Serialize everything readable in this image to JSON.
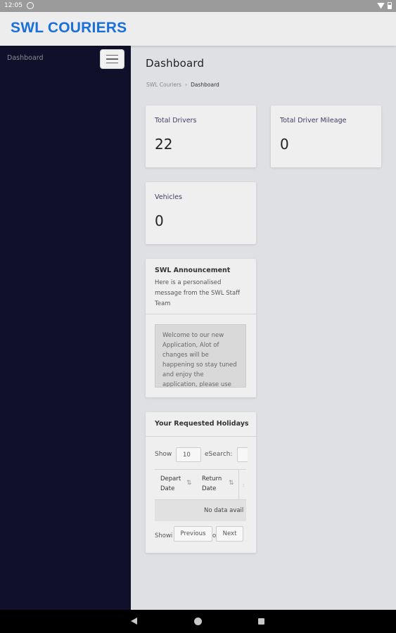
{
  "status_bar": {
    "time": "12:05"
  },
  "app": {
    "brand": "SWL COURIERS",
    "accent_color": "#1a6fd8",
    "sidebar_color": "#10102a"
  },
  "sidebar": {
    "title": "Dashboard",
    "menu_icon": "hamburger-icon"
  },
  "page": {
    "title": "Dashboard",
    "breadcrumb": [
      "SWL Couriers",
      "Dashboard"
    ]
  },
  "stats": [
    {
      "label": "Total Drivers",
      "value": "22"
    },
    {
      "label": "Total Driver Mileage",
      "value": "0"
    },
    {
      "label": "Vehicles",
      "value": "0"
    }
  ],
  "announcement": {
    "title": "SWL Announcement",
    "subtitle": "Here is a personalised message from the SWL Staff Team",
    "message": "Welcome to our new Application, Alot of changes will be happening so stay tuned and enjoy the application, please use"
  },
  "holidays": {
    "title": "Your Requested Holidays",
    "show_label": "Show",
    "page_length": "10",
    "entries_label": "e",
    "search_label": "Search:",
    "columns": [
      "Depart Date",
      "Return Date"
    ],
    "sort_icon": "⇅",
    "empty_text": "No data avail",
    "showing_text": "Showi",
    "showing_tail": "o",
    "prev_label": "Previous",
    "next_label": "Next"
  },
  "nav_bar": {
    "icons": [
      "back-icon",
      "home-icon",
      "recents-icon"
    ]
  }
}
